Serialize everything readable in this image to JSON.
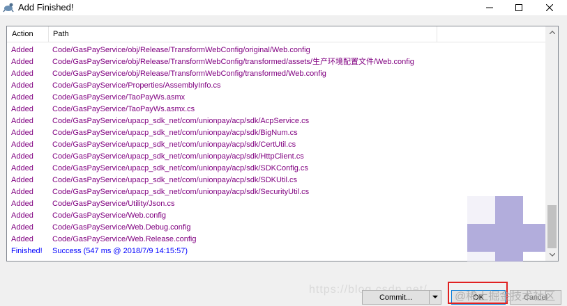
{
  "window": {
    "title": "Add Finished!",
    "minimize_icon": "minimize-icon",
    "maximize_icon": "maximize-icon",
    "close_icon": "close-icon"
  },
  "list": {
    "columns": [
      "Action",
      "Path"
    ],
    "rows": [
      {
        "action": "Added",
        "path": "Code/GasPayService/obj/Release/TransformWebConfig/original/Web.config"
      },
      {
        "action": "Added",
        "path": "Code/GasPayService/obj/Release/TransformWebConfig/transformed/assets/生产环境配置文件/Web.config"
      },
      {
        "action": "Added",
        "path": "Code/GasPayService/obj/Release/TransformWebConfig/transformed/Web.config"
      },
      {
        "action": "Added",
        "path": "Code/GasPayService/Properties/AssemblyInfo.cs"
      },
      {
        "action": "Added",
        "path": "Code/GasPayService/TaoPayWs.asmx"
      },
      {
        "action": "Added",
        "path": "Code/GasPayService/TaoPayWs.asmx.cs"
      },
      {
        "action": "Added",
        "path": "Code/GasPayService/upacp_sdk_net/com/unionpay/acp/sdk/AcpService.cs"
      },
      {
        "action": "Added",
        "path": "Code/GasPayService/upacp_sdk_net/com/unionpay/acp/sdk/BigNum.cs"
      },
      {
        "action": "Added",
        "path": "Code/GasPayService/upacp_sdk_net/com/unionpay/acp/sdk/CertUtil.cs"
      },
      {
        "action": "Added",
        "path": "Code/GasPayService/upacp_sdk_net/com/unionpay/acp/sdk/HttpClient.cs"
      },
      {
        "action": "Added",
        "path": "Code/GasPayService/upacp_sdk_net/com/unionpay/acp/sdk/SDKConfig.cs"
      },
      {
        "action": "Added",
        "path": "Code/GasPayService/upacp_sdk_net/com/unionpay/acp/sdk/SDKUtil.cs"
      },
      {
        "action": "Added",
        "path": "Code/GasPayService/upacp_sdk_net/com/unionpay/acp/sdk/SecurityUtil.cs"
      },
      {
        "action": "Added",
        "path": "Code/GasPayService/Utility/Json.cs"
      },
      {
        "action": "Added",
        "path": "Code/GasPayService/Web.config"
      },
      {
        "action": "Added",
        "path": "Code/GasPayService/Web.Debug.config"
      },
      {
        "action": "Added",
        "path": "Code/GasPayService/Web.Release.config"
      },
      {
        "action": "Finished!",
        "path": "Success (547 ms @ 2018/7/9 14:15:57)"
      }
    ]
  },
  "footer": {
    "commit_label": "Commit...",
    "ok_label": "OK",
    "cancel_label": "Cancel",
    "url_watermark": "https://blog.csdn.net/",
    "brand_watermark": "@稀土掘金技术社区"
  },
  "colors": {
    "added": "#800080",
    "finished": "#0000ff",
    "highlight": "#e02020"
  }
}
